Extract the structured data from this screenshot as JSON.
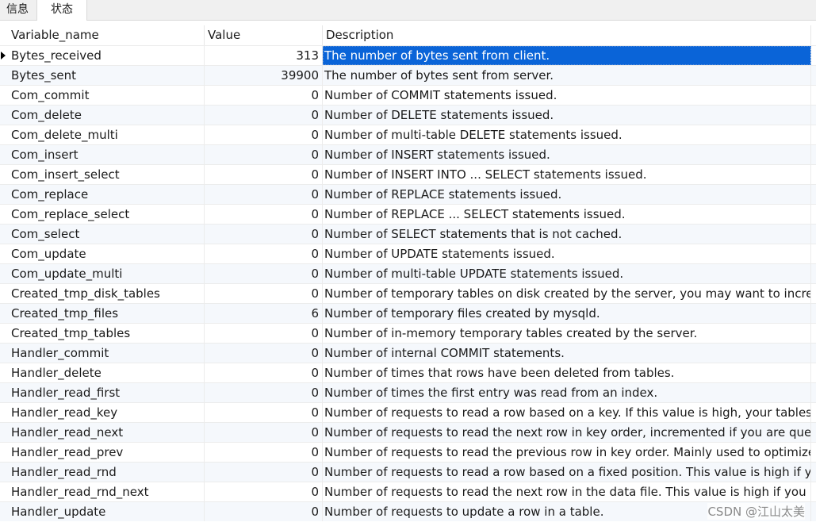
{
  "tabs": [
    {
      "label": "信息"
    },
    {
      "label": "状态"
    }
  ],
  "table": {
    "columns": {
      "name": "Variable_name",
      "value": "Value",
      "description": "Description"
    },
    "rows": [
      {
        "name": "Bytes_received",
        "value": "313",
        "description": "The number of bytes sent from client.",
        "selected": true
      },
      {
        "name": "Bytes_sent",
        "value": "39900",
        "description": "The number of bytes sent from server."
      },
      {
        "name": "Com_commit",
        "value": "0",
        "description": "Number of COMMIT statements issued."
      },
      {
        "name": "Com_delete",
        "value": "0",
        "description": "Number of DELETE statements issued."
      },
      {
        "name": "Com_delete_multi",
        "value": "0",
        "description": "Number of multi-table DELETE statements issued."
      },
      {
        "name": "Com_insert",
        "value": "0",
        "description": "Number of INSERT statements issued."
      },
      {
        "name": "Com_insert_select",
        "value": "0",
        "description": "Number of INSERT INTO ... SELECT statements issued."
      },
      {
        "name": "Com_replace",
        "value": "0",
        "description": "Number of REPLACE statements issued."
      },
      {
        "name": "Com_replace_select",
        "value": "0",
        "description": "Number of REPLACE ... SELECT statements issued."
      },
      {
        "name": "Com_select",
        "value": "0",
        "description": "Number of SELECT statements that is not cached."
      },
      {
        "name": "Com_update",
        "value": "0",
        "description": "Number of UPDATE statements issued."
      },
      {
        "name": "Com_update_multi",
        "value": "0",
        "description": "Number of multi-table UPDATE statements issued."
      },
      {
        "name": "Created_tmp_disk_tables",
        "value": "0",
        "description": "Number of temporary tables on disk created by the server, you may want to increase"
      },
      {
        "name": "Created_tmp_files",
        "value": "6",
        "description": "Number of temporary files created by mysqld."
      },
      {
        "name": "Created_tmp_tables",
        "value": "0",
        "description": "Number of in-memory temporary tables created by the server."
      },
      {
        "name": "Handler_commit",
        "value": "0",
        "description": "Number of internal COMMIT statements."
      },
      {
        "name": "Handler_delete",
        "value": "0",
        "description": "Number of times that rows have been deleted from tables."
      },
      {
        "name": "Handler_read_first",
        "value": "0",
        "description": "Number of times the first entry was read from an index."
      },
      {
        "name": "Handler_read_key",
        "value": "0",
        "description": "Number of requests to read a row based on a key. If this value is high, your tables ma"
      },
      {
        "name": "Handler_read_next",
        "value": "0",
        "description": "Number of requests to read the next row in key order, incremented if you are queryi"
      },
      {
        "name": "Handler_read_prev",
        "value": "0",
        "description": "Number of requests to read the previous row in key order. Mainly used to optimize C"
      },
      {
        "name": "Handler_read_rnd",
        "value": "0",
        "description": "Number of requests to read a row based on a fixed position. This value is high if you"
      },
      {
        "name": "Handler_read_rnd_next",
        "value": "0",
        "description": "Number of requests to read the next row in the data file. This value is high if you are"
      },
      {
        "name": "Handler_update",
        "value": "0",
        "description": "Number of requests to update a row in a table."
      }
    ]
  },
  "watermark": "CSDN @江山太美",
  "colors": {
    "selection": "#0a64d8",
    "alt_row": "#f5f8fc"
  }
}
